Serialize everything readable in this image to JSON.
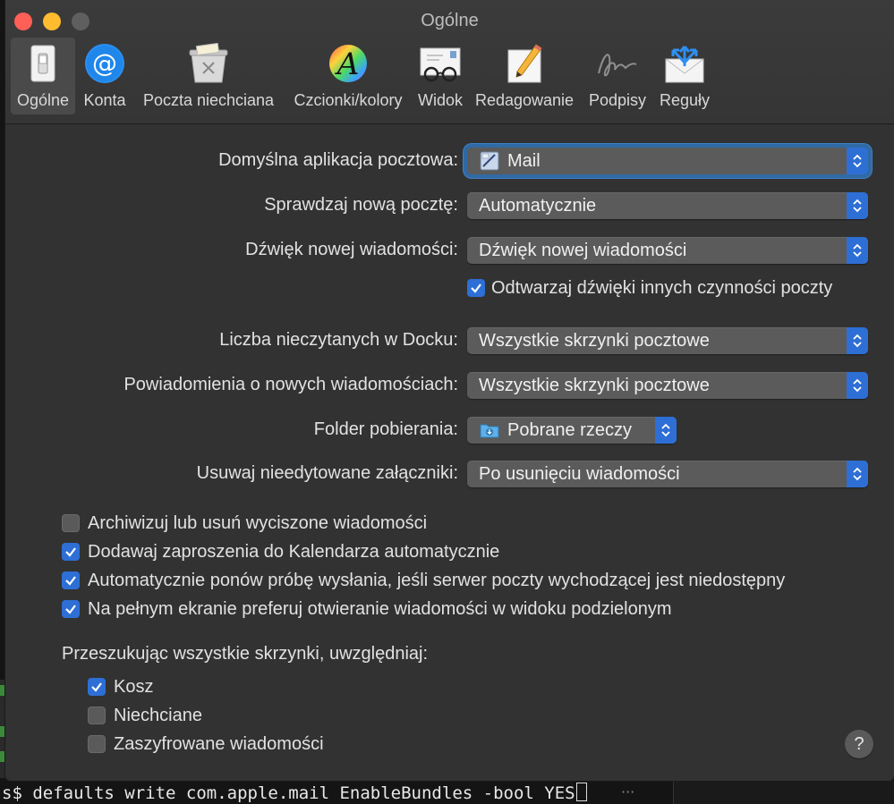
{
  "window": {
    "title": "Ogólne"
  },
  "toolbar": {
    "items": [
      {
        "label": "Ogólne",
        "icon": "switch-icon",
        "selected": true
      },
      {
        "label": "Konta",
        "icon": "at-sign-icon"
      },
      {
        "label": "Poczta niechciana",
        "icon": "junk-bin-icon"
      },
      {
        "label": "Czcionki/kolory",
        "icon": "font-colors-icon"
      },
      {
        "label": "Widok",
        "icon": "glasses-envelope-icon"
      },
      {
        "label": "Redagowanie",
        "icon": "pencil-paper-icon"
      },
      {
        "label": "Podpisy",
        "icon": "signature-icon"
      },
      {
        "label": "Reguły",
        "icon": "rules-envelope-icon"
      }
    ]
  },
  "form": {
    "default_mail_app": {
      "label": "Domyślna aplikacja pocztowa:",
      "value": "Mail"
    },
    "check_new_mail": {
      "label": "Sprawdzaj nową pocztę:",
      "value": "Automatycznie"
    },
    "new_message_sound": {
      "label": "Dźwięk nowej wiadomości:",
      "value": "Dźwięk nowej wiadomości"
    },
    "play_other_sounds": {
      "label": "Odtwarzaj dźwięki innych czynności poczty",
      "checked": true
    },
    "dock_unread_count": {
      "label": "Liczba nieczytanych w Docku:",
      "value": "Wszystkie skrzynki pocztowe"
    },
    "new_message_notifications": {
      "label": "Powiadomienia o nowych wiadomościach:",
      "value": "Wszystkie skrzynki pocztowe"
    },
    "downloads_folder": {
      "label": "Folder pobierania:",
      "value": "Pobrane rzeczy"
    },
    "remove_unedited_attachments": {
      "label": "Usuwaj nieedytowane załączniki:",
      "value": "Po usunięciu wiadomości"
    }
  },
  "options": [
    {
      "label": "Archiwizuj lub usuń wyciszone wiadomości",
      "checked": false
    },
    {
      "label": "Dodawaj zaproszenia do Kalendarza automatycznie",
      "checked": true
    },
    {
      "label": "Automatycznie ponów próbę wysłania, jeśli serwer poczty wychodzącej jest niedostępny",
      "checked": true
    },
    {
      "label": "Na pełnym ekranie preferuj otwieranie wiadomości w widoku podzielonym",
      "checked": true
    }
  ],
  "search": {
    "heading": "Przeszukując wszystkie skrzynki, uwzględniaj:",
    "items": [
      {
        "label": "Kosz",
        "checked": true
      },
      {
        "label": "Niechciane",
        "checked": false
      },
      {
        "label": "Zaszyfrowane wiadomości",
        "checked": false
      }
    ]
  },
  "help": {
    "label": "?"
  },
  "terminal": {
    "command": "s$ defaults write com.apple.mail EnableBundles -bool YES",
    "dots": "···"
  },
  "colors": {
    "accent": "#2e6fd6",
    "window_bg": "#323232",
    "popup_bg": "#5b5b5b"
  }
}
